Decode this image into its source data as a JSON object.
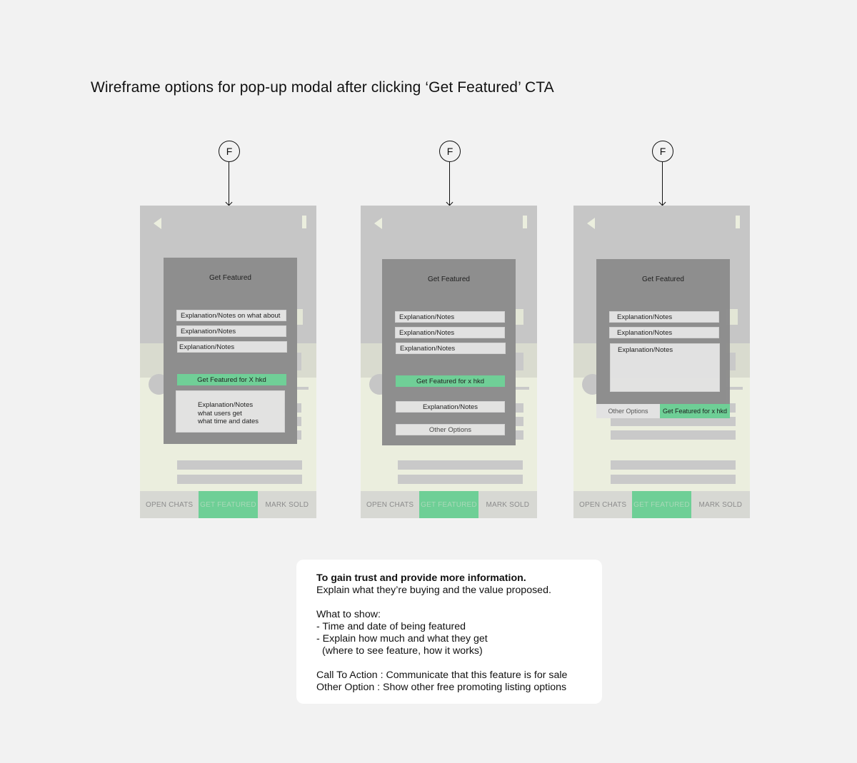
{
  "page": {
    "title": "Wireframe options for pop-up modal after clicking ‘Get Featured’ CTA",
    "background_color": "#f2f2f2",
    "accent_color": "#6ecf96"
  },
  "marker_label": "F",
  "nav": {
    "open_chats": "OPEN CHATS",
    "get_featured": "GET FEATURED",
    "mark_sold": "MARK SOLD",
    "active": "GET FEATURED"
  },
  "options": [
    {
      "modal_title": "Get Featured",
      "fields": [
        "Explanation/Notes on what about",
        "Explanation/Notes",
        "Explanation/Notes"
      ],
      "cta": "Get Featured for X hkd",
      "notes_box": [
        "Explanation/Notes",
        "what  users get",
        "what time and dates"
      ]
    },
    {
      "modal_title": "Get Featured",
      "fields": [
        "Explanation/Notes",
        "Explanation/Notes",
        "Explanation/Notes"
      ],
      "cta": "Get Featured for x hkd",
      "extra_field": "Explanation/Notes",
      "other_options": "Other Options"
    },
    {
      "modal_title": "Get Featured",
      "fields": [
        "Explanation/Notes",
        "Explanation/Notes",
        "Explanation/Notes"
      ],
      "other_options": "Other Options",
      "cta": "Get Featured for x hkd"
    }
  ],
  "note": {
    "heading": "To gain trust and provide more information.",
    "line1": "Explain what they’re buying and the value proposed.",
    "what_to_show": "What to show:",
    "bullet1": "- Time and date of being featured",
    "bullet2": "- Explain how much and what they get",
    "bullet2_sub": "(where to see feature, how it works)",
    "cta_line": "Call To Action : Communicate that this feature is for sale",
    "other_line": "Other Option : Show other free promoting listing options"
  }
}
